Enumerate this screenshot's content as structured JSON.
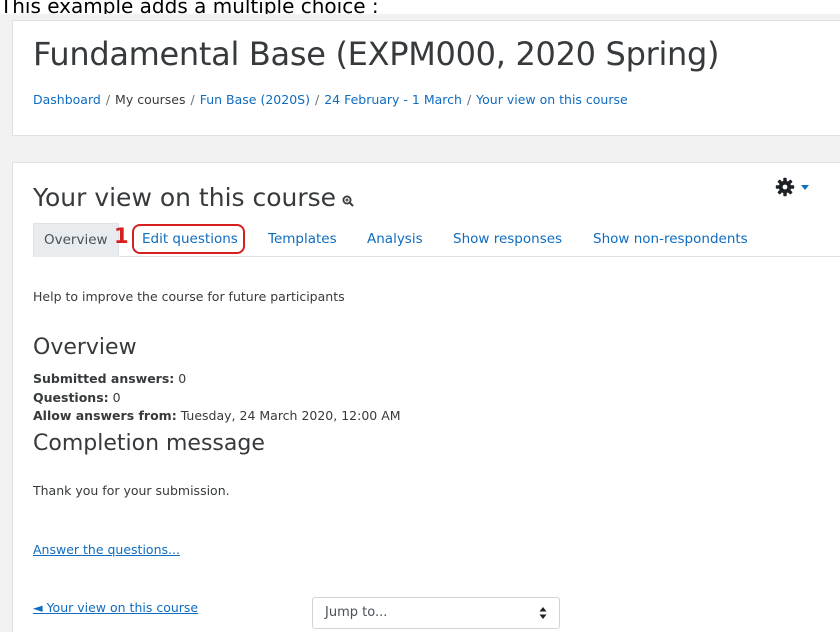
{
  "caption": "This example adds a multiple choice :",
  "course": {
    "title": "Fundamental Base (EXPM000, 2020 Spring)",
    "breadcrumb": [
      "Dashboard",
      "My courses",
      "Fun Base (2020S)",
      "24 February - 1 March",
      "Your view on this course"
    ],
    "breadcrumb_sep": "/"
  },
  "main": {
    "heading": "Your view on this course",
    "tabs": [
      "Overview",
      "Edit questions",
      "Templates",
      "Analysis",
      "Show responses",
      "Show non-respondents"
    ],
    "active_tab": "Overview",
    "annotation_marker": "1",
    "intro": "Help to improve the course for future participants",
    "overview_heading": "Overview",
    "submitted_label": "Submitted answers:",
    "submitted_value": "0",
    "questions_label": "Questions:",
    "questions_value": "0",
    "allow_label": "Allow answers from:",
    "allow_value": "Tuesday, 24 March 2020, 12:00 AM",
    "completion_heading": "Completion message",
    "completion_text": "Thank you for your submission.",
    "answer_link": "Answer the questions...",
    "prev_link": "◄ Your view on this course",
    "jump_placeholder": "Jump to..."
  },
  "icons": {
    "zoom": "magnifier-icon",
    "gear": "gear-icon",
    "caret": "caret-down-icon"
  },
  "colors": {
    "link": "#0f6cbf",
    "highlight": "#d61f1f",
    "text": "#373a3c"
  }
}
